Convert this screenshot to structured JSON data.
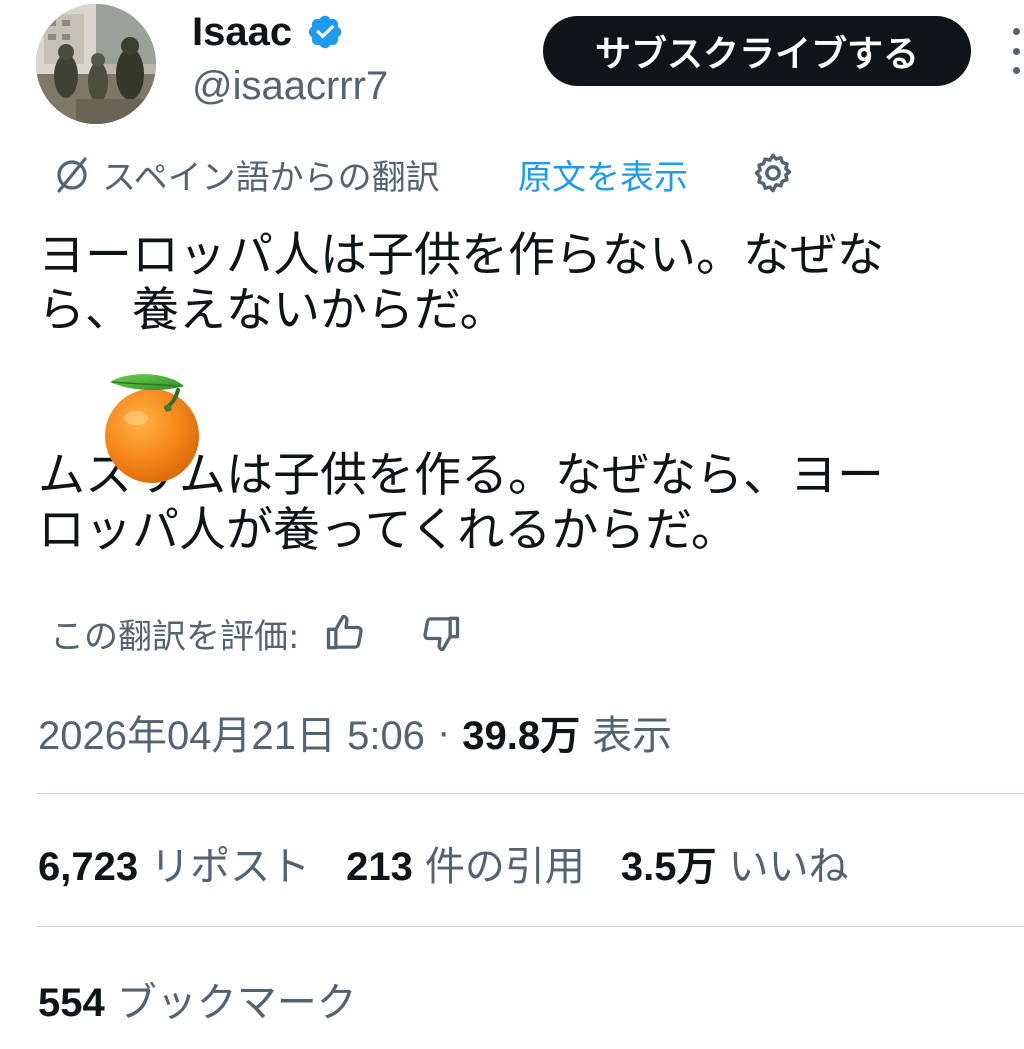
{
  "author": {
    "display_name": "Isaac",
    "handle": "@isaacrrr7",
    "verified": true
  },
  "subscribe_label": "サブスクライブする",
  "translation": {
    "source_label": "スペイン語からの翻訳",
    "show_original_label": "原文を表示"
  },
  "tweet": {
    "lines": [
      "ヨーロッパ人は子供を作らない。なぜな",
      "ら、養えないからだ。",
      "ムスリムは子供を作る。なぜなら、ヨー",
      "ロッパ人が養ってくれるからだ。"
    ],
    "emoji": "🍊"
  },
  "rate_translation_label": "この翻訳を評価:",
  "meta": {
    "timestamp": "2026年04月21日 5:06",
    "separator": "·",
    "views_count": "39.8万",
    "views_label": "表示"
  },
  "stats": {
    "reposts_count": "6,723",
    "reposts_label": "リポスト",
    "quotes_count": "213",
    "quotes_label": "件の引用",
    "likes_count": "3.5万",
    "likes_label": "いいね",
    "bookmarks_count": "554",
    "bookmarks_label": "ブックマーク"
  },
  "colors": {
    "text_primary": "#0f1419",
    "text_secondary": "#536471",
    "accent": "#1d9bf0",
    "divider": "#cfd9de"
  },
  "icons": {
    "verified": "verified-badge-icon",
    "translate": "translate-icon",
    "settings": "gear-icon",
    "thumb_up": "thumbs-up-icon",
    "thumb_down": "thumbs-down-icon",
    "more": "more-vertical-icon"
  }
}
